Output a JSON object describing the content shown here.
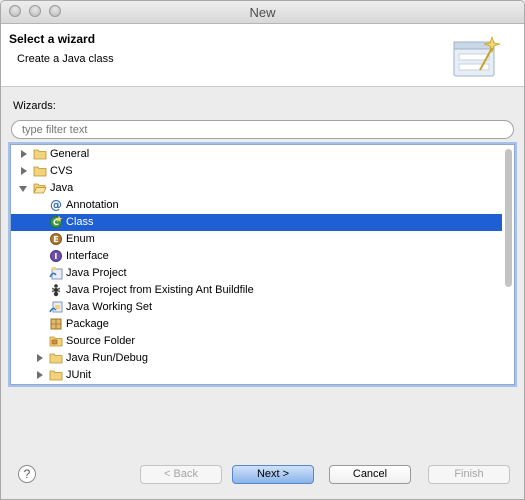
{
  "window": {
    "title": "New"
  },
  "header": {
    "title": "Select a wizard",
    "message": "Create a Java class"
  },
  "wizards": {
    "label": "Wizards:",
    "filter_placeholder": "type filter text",
    "items": [
      {
        "label": "General",
        "depth": 0,
        "arrow": "right",
        "icon": "folder-icon",
        "selected": false
      },
      {
        "label": "CVS",
        "depth": 0,
        "arrow": "right",
        "icon": "folder-icon",
        "selected": false
      },
      {
        "label": "Java",
        "depth": 0,
        "arrow": "down",
        "icon": "folder-open-icon",
        "selected": false
      },
      {
        "label": "Annotation",
        "depth": 1,
        "arrow": "",
        "icon": "annotation-icon",
        "selected": false
      },
      {
        "label": "Class",
        "depth": 1,
        "arrow": "",
        "icon": "class-icon",
        "selected": true
      },
      {
        "label": "Enum",
        "depth": 1,
        "arrow": "",
        "icon": "enum-icon",
        "selected": false
      },
      {
        "label": "Interface",
        "depth": 1,
        "arrow": "",
        "icon": "interface-icon",
        "selected": false
      },
      {
        "label": "Java Project",
        "depth": 1,
        "arrow": "",
        "icon": "java-project-icon",
        "selected": false
      },
      {
        "label": "Java Project from Existing Ant Buildfile",
        "depth": 1,
        "arrow": "",
        "icon": "ant-icon",
        "selected": false
      },
      {
        "label": "Java Working Set",
        "depth": 1,
        "arrow": "",
        "icon": "working-set-icon",
        "selected": false
      },
      {
        "label": "Package",
        "depth": 1,
        "arrow": "",
        "icon": "package-icon",
        "selected": false
      },
      {
        "label": "Source Folder",
        "depth": 1,
        "arrow": "",
        "icon": "source-folder-icon",
        "selected": false
      },
      {
        "label": "Java Run/Debug",
        "depth": 1,
        "arrow": "right",
        "icon": "folder-icon",
        "selected": false
      },
      {
        "label": "JUnit",
        "depth": 1,
        "arrow": "right",
        "icon": "folder-icon",
        "selected": false
      }
    ]
  },
  "buttons": {
    "help": "?",
    "back": "< Back",
    "next": "Next >",
    "cancel": "Cancel",
    "finish": "Finish"
  },
  "colors": {
    "selection": "#1e5fd4",
    "folder": "#e9c46a",
    "java_blue": "#3a6fb0",
    "default_button": "#8bb3ea"
  }
}
